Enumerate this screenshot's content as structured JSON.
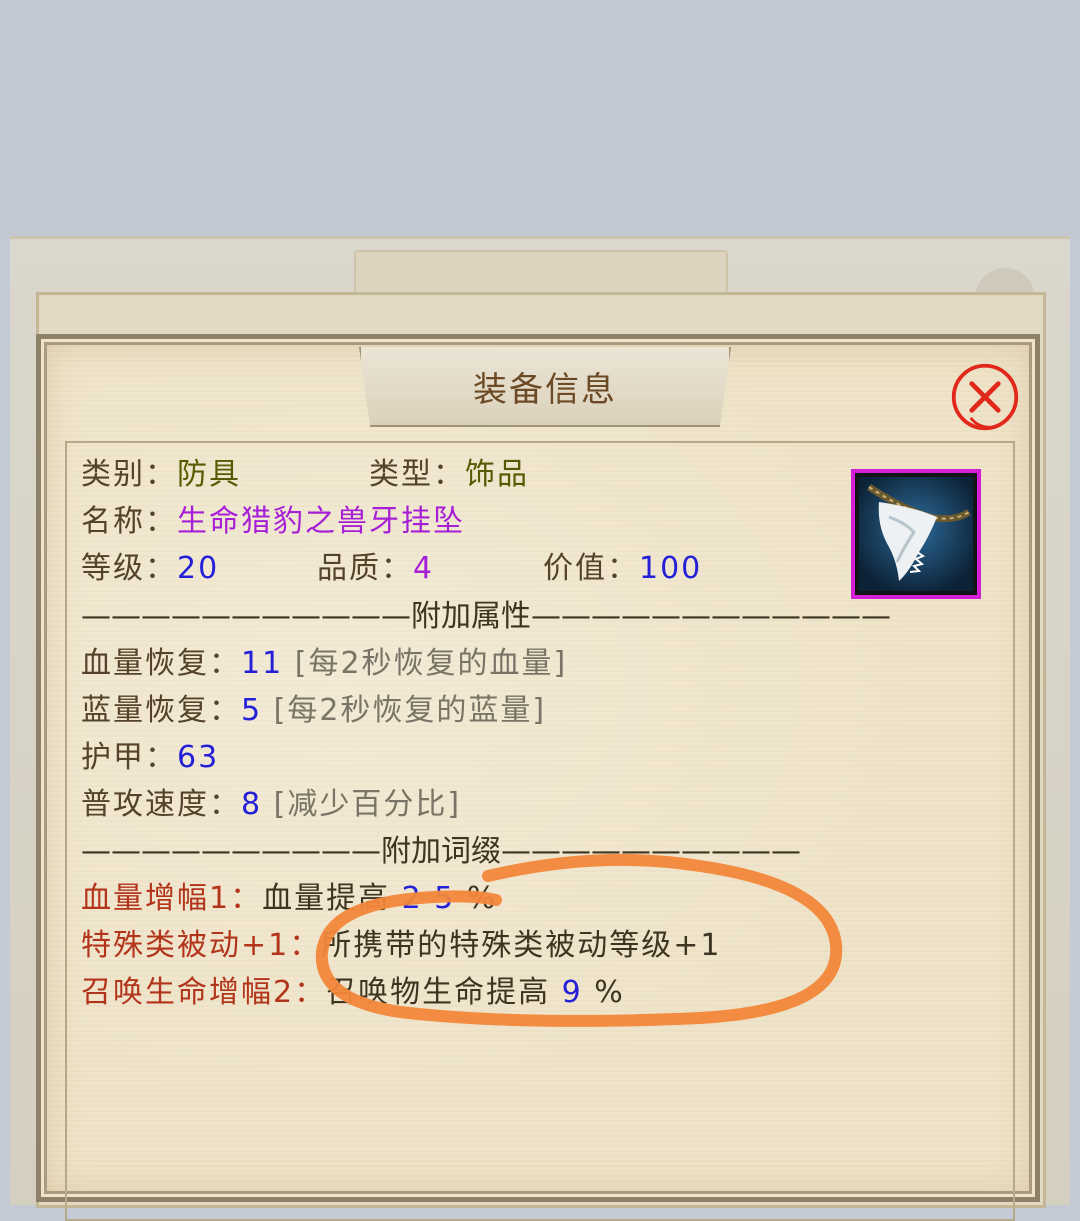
{
  "dialog": {
    "title": "装备信息"
  },
  "item": {
    "category_label": "类别：",
    "category_value": "防具",
    "type_label": "类型：",
    "type_value": "饰品",
    "name_label": "名称：",
    "name_value": "生命猎豹之兽牙挂坠",
    "level_label": "等级：",
    "level_value": "20",
    "quality_label": "品质：",
    "quality_value": "4",
    "price_label": "价值：",
    "price_value": "100",
    "icon": "beast-fang-pendant-icon"
  },
  "attributes": {
    "divider": "———————————附加属性————————————",
    "hp_regen_label": "血量恢复：",
    "hp_regen_value": "11",
    "hp_regen_note": "[每2秒恢复的血量]",
    "mp_regen_label": "蓝量恢复：",
    "mp_regen_value": "5",
    "mp_regen_note": "[每2秒恢复的蓝量]",
    "armor_label": "护甲：",
    "armor_value": "63",
    "atk_speed_label": "普攻速度：",
    "atk_speed_value": "8",
    "atk_speed_note": "[减少百分比]"
  },
  "affixes": {
    "divider": "——————————附加词缀——————————",
    "affix1_label": "血量增幅1：",
    "affix1_text": "血量提高",
    "affix1_value": "2 5",
    "affix1_unit": "%",
    "affix2_label": "特殊类被动+1：",
    "affix2_text": "所携带的特殊类被动等级+1",
    "affix3_label": "召唤生命增幅2：",
    "affix3_text": "召唤物生命提高",
    "affix3_value": "9",
    "affix3_unit": "%"
  },
  "colors": {
    "annotation": "#f2873a",
    "quality_border": "#d41fd8",
    "value_blue": "#2420d8",
    "name_purple": "#a61fd6",
    "affix_red": "#b2341b"
  }
}
